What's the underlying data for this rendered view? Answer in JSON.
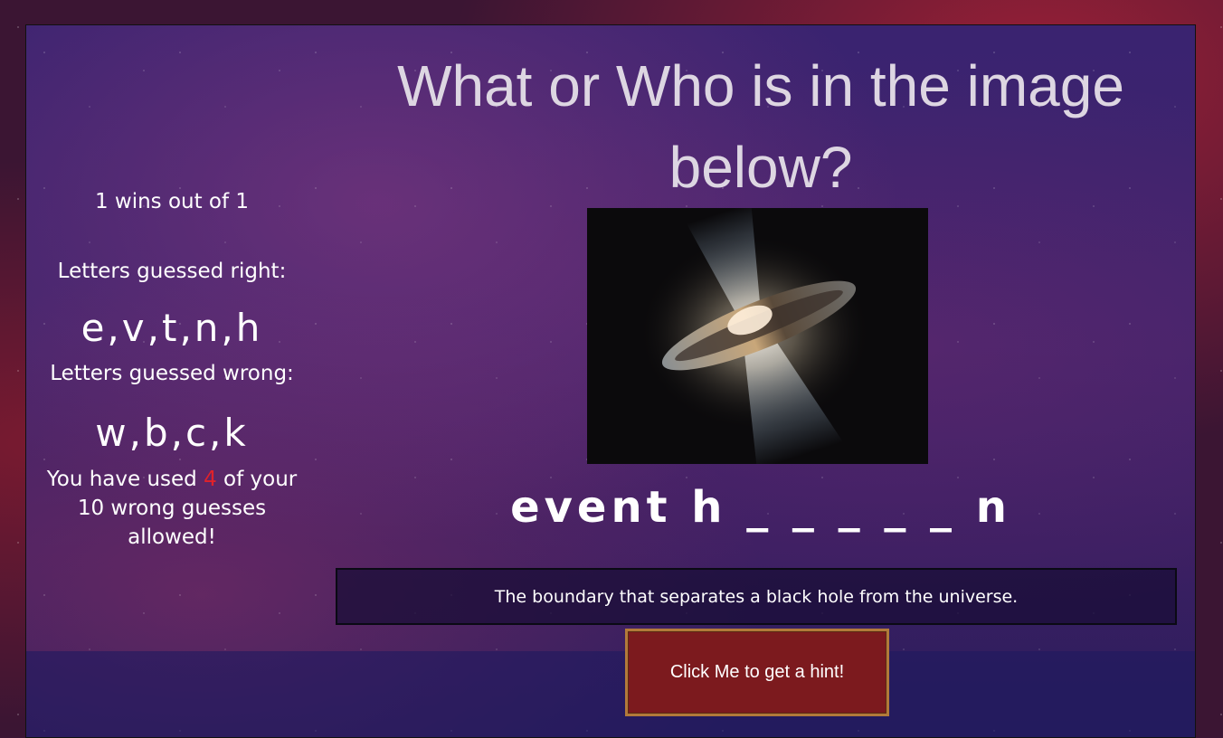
{
  "title": "What or Who is in the image below?",
  "sidebar": {
    "wins_text": "1 wins out of 1",
    "right_label": "Letters guessed right:",
    "right_letters": "e,v,t,n,h",
    "wrong_label": "Letters guessed wrong:",
    "wrong_letters": "w,b,c,k",
    "used_prefix": "You have used",
    "used_count": "4",
    "used_suffix": "of your 10 wrong guesses allowed!"
  },
  "clue_image": {
    "icon": "black-hole-illustration"
  },
  "puzzle": {
    "display": "event h _ _ _ _ _ n"
  },
  "hint": {
    "text": "The boundary that separates a black hole from the universe.",
    "button_label": "Click Me to get a hint!"
  },
  "colors": {
    "accent_red": "#e0222a",
    "button_bg": "#7c1a1e",
    "button_border": "#b27a3a"
  }
}
